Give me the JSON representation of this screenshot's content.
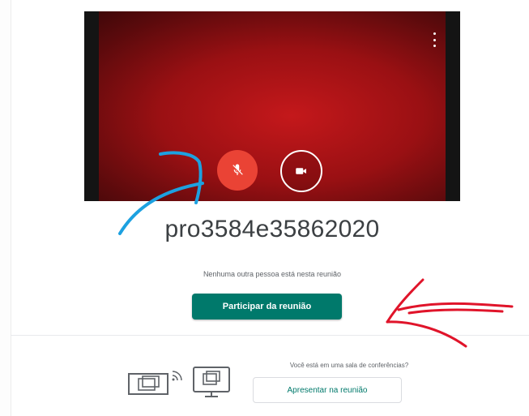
{
  "preview": {
    "more_options_icon": "more-vert-icon",
    "mic_button": {
      "icon": "mic-off-icon",
      "color": "#ea4335",
      "state": "muted"
    },
    "camera_button": {
      "icon": "videocam-icon",
      "state": "on"
    }
  },
  "meeting": {
    "code": "pro3584e35862020",
    "status": "Nenhuma outra pessoa está nesta reunião",
    "join_label": "Participar da reunião",
    "join_color": "#00796b"
  },
  "present": {
    "question": "Você está em uma sala de conferências?",
    "button_label": "Apresentar na reunião",
    "icon": "cast-to-room-icon"
  },
  "annotations": {
    "blue_arrow_color": "#1da1e0",
    "red_arrow_color": "#e0142a"
  }
}
